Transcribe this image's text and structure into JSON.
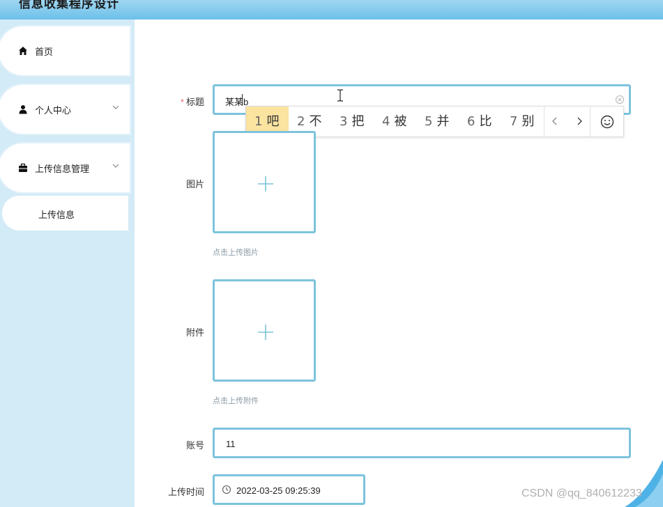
{
  "app": {
    "title": "信息收集程序设计"
  },
  "sidebar": {
    "items": [
      {
        "label": "首页",
        "icon": "home-icon"
      },
      {
        "label": "个人中心",
        "icon": "user-icon"
      },
      {
        "label": "上传信息管理",
        "icon": "briefcase-icon"
      }
    ],
    "sub_items": [
      {
        "label": "上传信息"
      }
    ]
  },
  "form": {
    "title": {
      "label": "标题",
      "required_mark": "*",
      "value": "某某b"
    },
    "image": {
      "label": "图片",
      "hint": "点击上传图片"
    },
    "attachment": {
      "label": "附件",
      "hint": "点击上传附件"
    },
    "account": {
      "label": "账号",
      "value": "11"
    },
    "upload_time": {
      "label": "上传时间",
      "value": "2022-03-25 09:25:39"
    }
  },
  "ime": {
    "candidates": [
      {
        "num": "1",
        "text": "吧",
        "selected": true
      },
      {
        "num": "2",
        "text": "不"
      },
      {
        "num": "3",
        "text": "把"
      },
      {
        "num": "4",
        "text": "被"
      },
      {
        "num": "5",
        "text": "并"
      },
      {
        "num": "6",
        "text": "比"
      },
      {
        "num": "7",
        "text": "别"
      }
    ]
  },
  "watermark": "CSDN @qq_840612233",
  "colors": {
    "accent_border": "#7cc3dc",
    "sidebar_bg": "#d3ebf7",
    "header_bg": "#6cc0ea",
    "ime_selected": "#fbe3a0",
    "required": "#f56c6c"
  }
}
